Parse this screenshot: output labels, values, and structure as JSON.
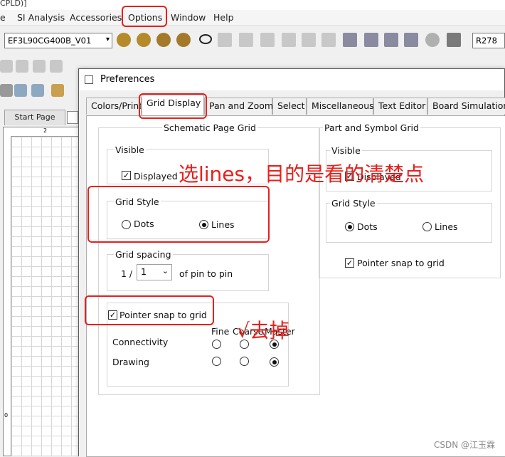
{
  "window": {
    "title_fragment": "CPLD)]"
  },
  "menubar": {
    "items": [
      "e",
      "SI Analysis",
      "Accessories",
      "Options",
      "Window",
      "Help"
    ]
  },
  "toolbar": {
    "part_combo": "EF3L90CG400B_V01",
    "ref_combo": "R278"
  },
  "start_tab": {
    "label": "Start Page"
  },
  "canvas": {
    "column_label": "2",
    "row_label": "0"
  },
  "dialog": {
    "title": "Preferences",
    "tabs": [
      "Colors/Print",
      "Grid Display",
      "Pan and Zoom",
      "Select",
      "Miscellaneous",
      "Text Editor",
      "Board Simulation"
    ],
    "active_tab": "Grid Display",
    "schematic": {
      "heading": "Schematic Page Grid",
      "visible": {
        "title": "Visible",
        "displayed_label": "Displayed",
        "displayed_checked": true
      },
      "grid_style": {
        "title": "Grid Style",
        "dots_label": "Dots",
        "lines_label": "Lines",
        "selected": "Lines"
      },
      "grid_spacing": {
        "title": "Grid spacing",
        "prefix": "1 /",
        "value": "1",
        "suffix": "of pin to pin"
      },
      "pointer_snap": {
        "label": "Pointer snap to grid",
        "checked": true
      },
      "snap_table": {
        "columns": [
          "Fine",
          "Coarse",
          "Master"
        ],
        "rows": [
          {
            "label": "Connectivity",
            "selected": "Master"
          },
          {
            "label": "Drawing",
            "selected": "Master"
          }
        ]
      }
    },
    "part_symbol": {
      "heading": "Part and Symbol Grid",
      "visible": {
        "title": "Visible",
        "displayed_label": "Displayed",
        "displayed_checked": true
      },
      "grid_style": {
        "title": "Grid Style",
        "dots_label": "Dots",
        "lines_label": "Lines",
        "selected": "Dots"
      },
      "pointer_snap": {
        "label": "Pointer snap to grid",
        "checked": true
      }
    }
  },
  "annotations": {
    "lines_note": "选lines，目的是看的清楚点",
    "uncheck_note": "√去掉"
  },
  "watermark": "CSDN @江玉霖",
  "colors": {
    "annotation_red": "#e8201c",
    "dialog_bg": "#f0f0f0"
  }
}
